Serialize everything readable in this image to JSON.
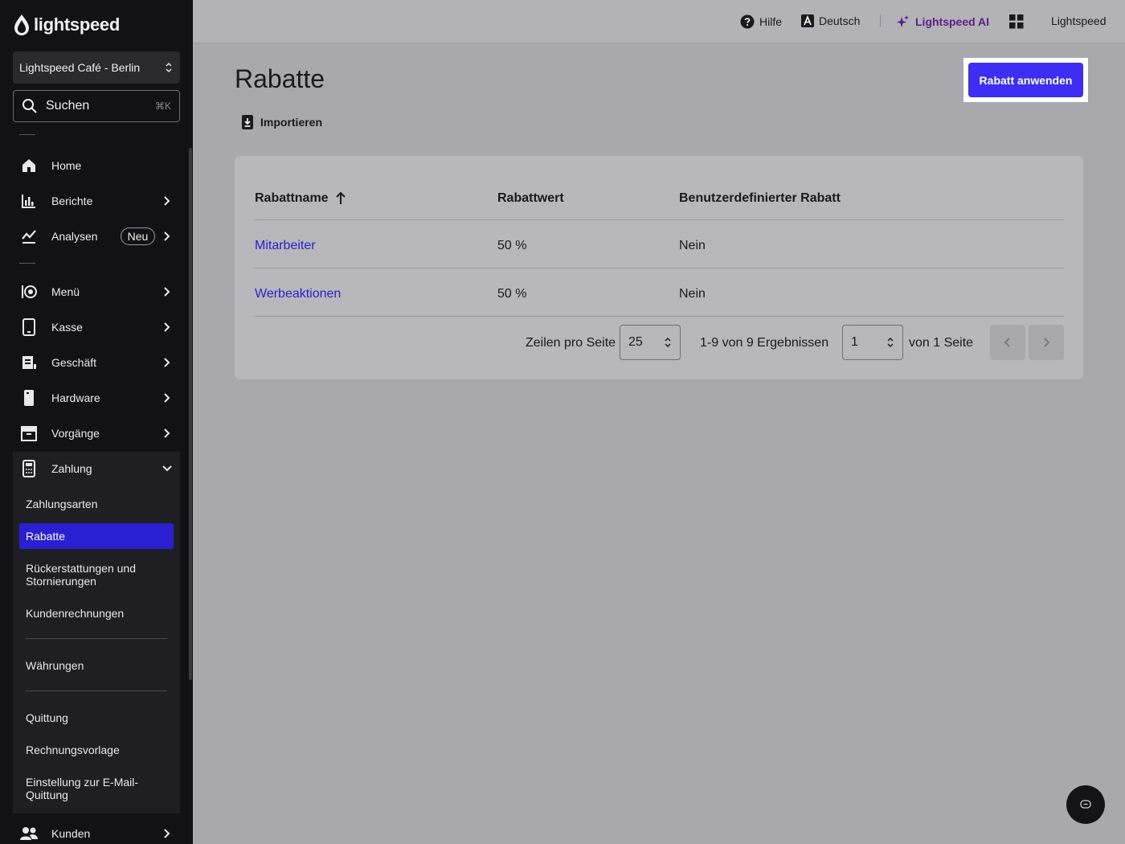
{
  "sidebar": {
    "logo_text": "lightspeed",
    "store_name": "Lightspeed Café - Berlin",
    "search": {
      "label": "Suchen",
      "shortcut": "⌘K"
    },
    "nav": [
      {
        "label": "Home",
        "icon": "home-icon"
      },
      {
        "label": "Berichte",
        "icon": "bar-chart-icon"
      },
      {
        "label": "Analysen",
        "icon": "analytics-icon",
        "badge": "Neu"
      },
      {
        "label": "Menü",
        "icon": "menu-icon"
      },
      {
        "label": "Kasse",
        "icon": "tablet-icon"
      },
      {
        "label": "Geschäft",
        "icon": "store-icon"
      },
      {
        "label": "Hardware",
        "icon": "hardware-icon"
      },
      {
        "label": "Vorgänge",
        "icon": "archive-icon"
      },
      {
        "label": "Zahlung",
        "icon": "payment-terminal-icon"
      },
      {
        "label": "Kunden",
        "icon": "customers-icon"
      }
    ],
    "zahlung_sub": [
      "Zahlungsarten",
      "Rabatte",
      "Rückerstattungen und Stornierungen",
      "Kundenrechnungen",
      "Währungen",
      "Quittung",
      "Rechnungsvorlage",
      "Einstellung zur E-Mail-Quittung"
    ]
  },
  "topbar": {
    "help": "Hilfe",
    "language": "Deutsch",
    "ai": "Lightspeed AI",
    "account": "Lightspeed"
  },
  "page": {
    "title": "Rabatte",
    "import_label": "Importieren",
    "apply_button": "Rabatt anwenden"
  },
  "table": {
    "columns": [
      "Rabattname",
      "Rabattwert",
      "Benutzerdefinierter Rabatt"
    ],
    "rows": [
      [
        "Mitarbeiter",
        "50 %",
        "Nein"
      ],
      [
        "Werbeaktionen",
        "50 %",
        "Nein"
      ]
    ]
  },
  "pagination": {
    "rows_per_page_label": "Zeilen pro Seite",
    "rows_per_page": "25",
    "results_text": "1-9 von 9 Ergebnissen",
    "current_page": "1",
    "of_pages": "von 1 Seite"
  },
  "colors": {
    "accent": "#3d2df5",
    "link": "#2b1fc8",
    "ai": "#5b1f8c",
    "sidebar_bg": "#121214",
    "active_nav": "#2a1fd1"
  }
}
